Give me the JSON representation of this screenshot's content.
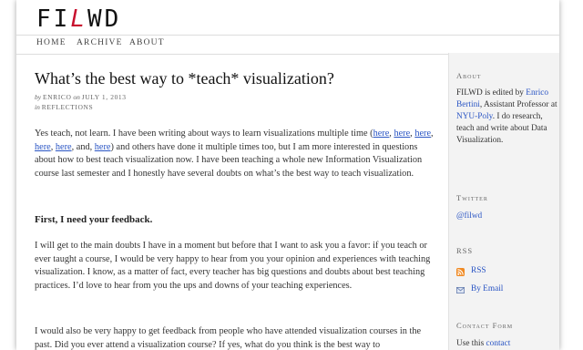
{
  "site": {
    "logo_left": "FI",
    "logo_accent": "L",
    "logo_right": "WD"
  },
  "nav": [
    {
      "label": "HOME"
    },
    {
      "label": "ARCHIVE"
    },
    {
      "label": "ABOUT"
    }
  ],
  "post": {
    "title": "What’s the best way to *teach* visualization?",
    "meta_by": "by",
    "author": "ENRICO",
    "meta_on": "on",
    "date": "JULY 1, 2013",
    "meta_in": "in",
    "category": "REFLECTIONS",
    "p1": {
      "a": "Yes teach, not learn. I have been writing about ways to learn visualizations multiple time (",
      "links": [
        "here",
        "here",
        "here",
        "here",
        "here",
        "here"
      ],
      "and": "and,",
      "b": ") and others have done it multiple times too, but I am more interested in questions about how to best teach visualization now. I have been teaching a whole new Information Visualization course last semester and I honestly have several doubts on what’s the best way to teach visualization."
    },
    "subhead": "First, I need your feedback.",
    "p2": "I will get to the main doubts I have in a moment but before that I want to ask you a favor: if you teach or ever taught a course, I would be very happy to hear from you your opinion and experiences with teaching visualization. I know, as a matter of fact, every teacher has big questions and doubts about best teaching practices. I’d love to hear from you the ups and downs of your teaching experiences.",
    "p3": "I would also be very happy to get feedback from people who have attended visualization courses in the past. Did you ever attend a visualization course? If yes, what do you think is the best way to"
  },
  "sidebar": {
    "about_heading": "About",
    "about_a": "FILWD is edited by",
    "about_name": "Enrico Bertini",
    "about_b": ", Assistant Professor at",
    "about_org": "NYU-Poly",
    "about_c": ". I do research, teach and write about Data Visualization.",
    "twitter_heading": "Twitter",
    "twitter_handle": "@filwd",
    "rss_heading": "RSS",
    "rss_link": "RSS",
    "email_link": "By Email",
    "contact_heading": "Contact Form",
    "contact_a": "Use this",
    "contact_link": "contact"
  },
  "colors": {
    "link": "#2a55c4",
    "accent": "#c8102e",
    "rss_orange": "#f08a24"
  },
  "icons": {
    "rss": "rss-icon",
    "email": "email-icon"
  }
}
